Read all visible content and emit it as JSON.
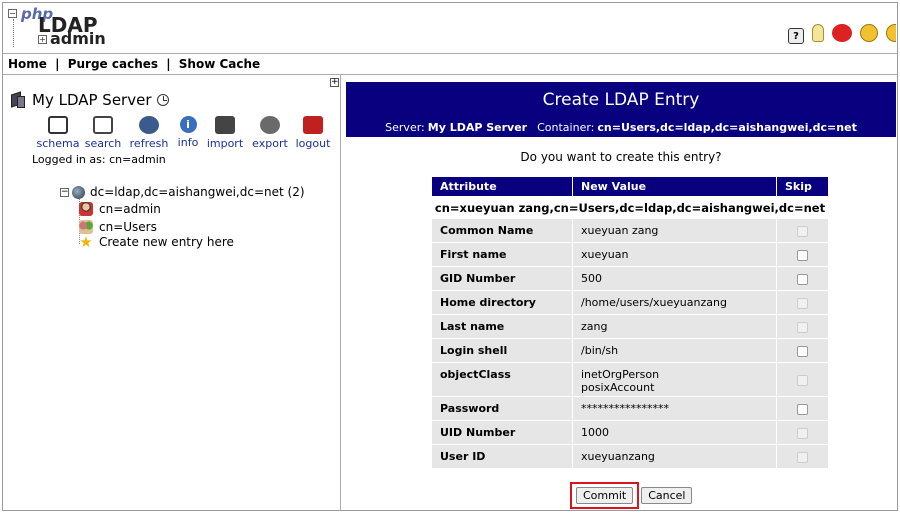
{
  "logo": {
    "php": "php",
    "ldap": "LDAP",
    "admin": "admin"
  },
  "header_icons": [
    "help-icon",
    "lightbulb-icon",
    "bug-icon",
    "smiley-icon",
    "smiley-partial-icon"
  ],
  "menu": {
    "home": "Home",
    "purge": "Purge caches",
    "show_cache": "Show Cache",
    "separator": "|"
  },
  "server": {
    "name": "My LDAP Server",
    "logged_in": "Logged in as: cn=admin"
  },
  "tools": [
    {
      "label": "schema",
      "icon": "schema-icon"
    },
    {
      "label": "search",
      "icon": "search-icon"
    },
    {
      "label": "refresh",
      "icon": "refresh-icon"
    },
    {
      "label": "info",
      "icon": "info-icon"
    },
    {
      "label": "import",
      "icon": "import-icon"
    },
    {
      "label": "export",
      "icon": "export-icon"
    },
    {
      "label": "logout",
      "icon": "logout-icon"
    }
  ],
  "tree": {
    "root": "dc=ldap,dc=aishangwei,dc=net (2)",
    "children": [
      "cn=admin",
      "cn=Users",
      "Create new entry here"
    ]
  },
  "form": {
    "title": "Create LDAP Entry",
    "server_label": "Server:",
    "server_value": "My LDAP Server",
    "container_label": "Container:",
    "container_value": "cn=Users,dc=ldap,dc=aishangwei,dc=net",
    "question": "Do you want to create this entry?",
    "headers": {
      "attribute": "Attribute",
      "new_value": "New Value",
      "skip": "Skip"
    },
    "dn": "cn=xueyuan zang,cn=Users,dc=ldap,dc=aishangwei,dc=net",
    "rows": [
      {
        "attr": "Common Name",
        "value": "xueyuan zang",
        "skip_disabled": true
      },
      {
        "attr": "First name",
        "value": "xueyuan",
        "skip_disabled": false
      },
      {
        "attr": "GID Number",
        "value": "500",
        "skip_disabled": false
      },
      {
        "attr": "Home directory",
        "value": "/home/users/xueyuanzang",
        "skip_disabled": true
      },
      {
        "attr": "Last name",
        "value": "zang",
        "skip_disabled": true
      },
      {
        "attr": "Login shell",
        "value": "/bin/sh",
        "skip_disabled": false
      },
      {
        "attr": "objectClass",
        "value": "inetOrgPerson",
        "value2": "posixAccount",
        "skip_disabled": true
      },
      {
        "attr": "Password",
        "value": "****************",
        "skip_disabled": false
      },
      {
        "attr": "UID Number",
        "value": "1000",
        "skip_disabled": true
      },
      {
        "attr": "User ID",
        "value": "xueyuanzang",
        "skip_disabled": true
      }
    ],
    "commit": "Commit",
    "cancel": "Cancel"
  }
}
